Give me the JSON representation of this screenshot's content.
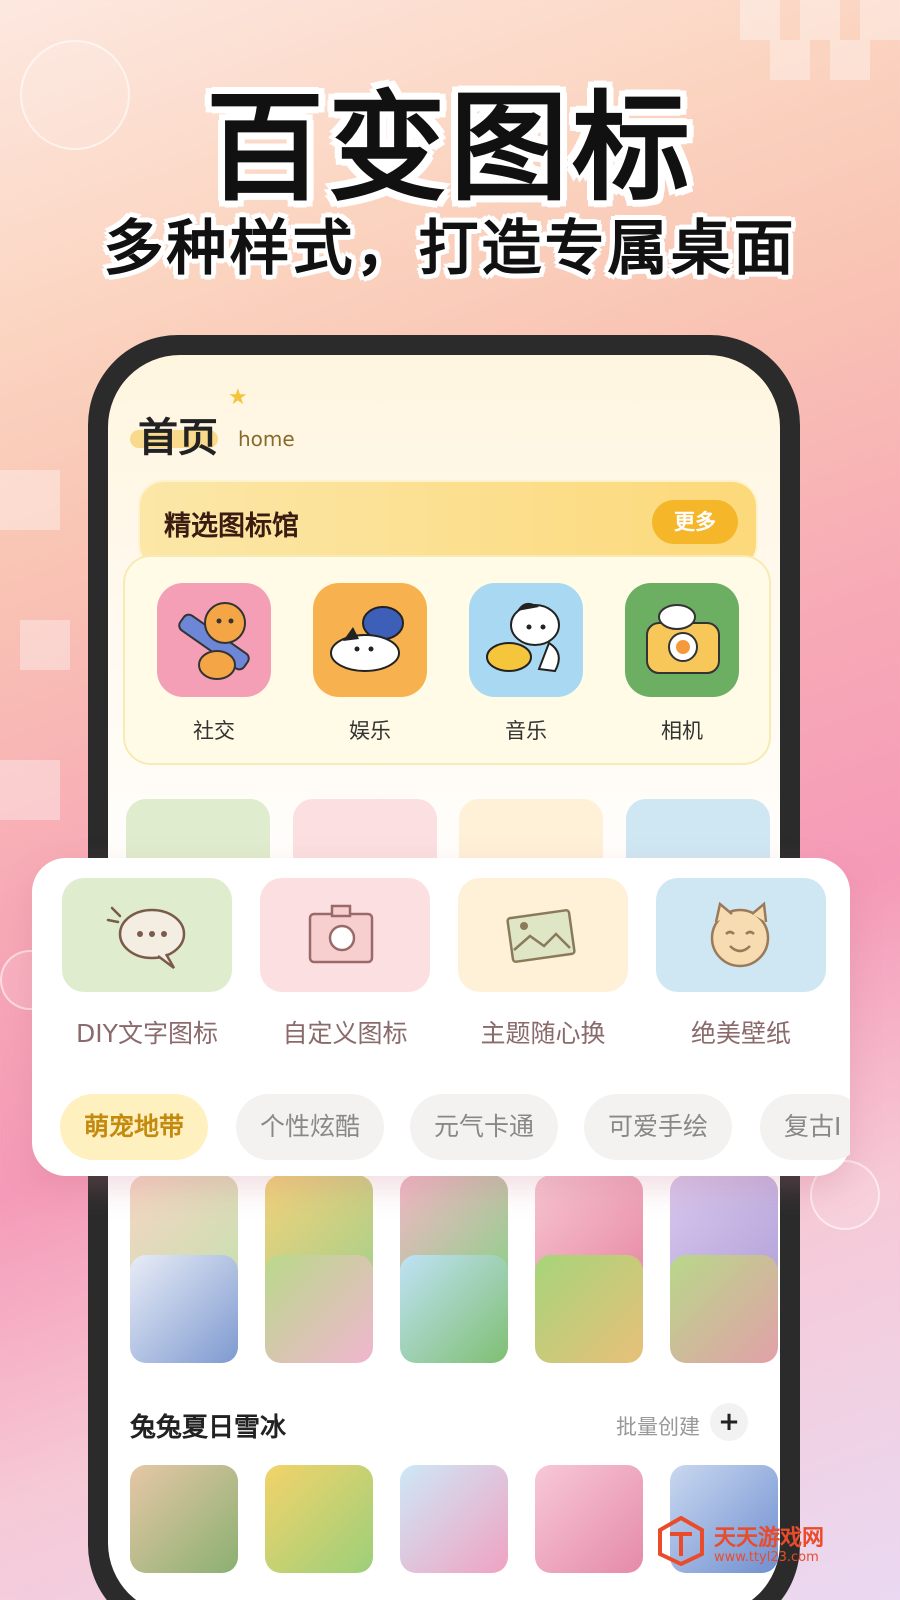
{
  "headline": "百变图标",
  "subline": "多种样式，打造专属桌面",
  "screen": {
    "home_title": "首页",
    "home_sub": "home",
    "featured_title": "精选图标馆",
    "more_label": "更多",
    "apps": [
      {
        "label": "社交",
        "icon": "tiger-pencil-icon",
        "color": "#f59fb6"
      },
      {
        "label": "娱乐",
        "icon": "dog-rabbit-icon",
        "color": "#f7b24f"
      },
      {
        "label": "音乐",
        "icon": "dog-duck-icon",
        "color": "#a9d8f2"
      },
      {
        "label": "相机",
        "icon": "camera-icon",
        "color": "#6cae62"
      }
    ],
    "section_title": "兔兔夏日雪冰",
    "batch_label": "批量创建",
    "plus_label": "+"
  },
  "features": [
    {
      "label": "DIY文字图标",
      "icon": "chat-bubble-icon",
      "color": "#dfeccd"
    },
    {
      "label": "自定义图标",
      "icon": "camera-icon",
      "color": "#fcdfe0"
    },
    {
      "label": "主题随心换",
      "icon": "picture-icon",
      "color": "#fff0d8"
    },
    {
      "label": "绝美壁纸",
      "icon": "cat-face-icon",
      "color": "#cfe7f3"
    }
  ],
  "chips": [
    {
      "label": "萌宠地带",
      "active": true
    },
    {
      "label": "个性炫酷",
      "active": false
    },
    {
      "label": "元气卡通",
      "active": false
    },
    {
      "label": "可爱手绘",
      "active": false
    },
    {
      "label": "复古I",
      "active": false
    }
  ],
  "watermark": {
    "name": "天天游戏网",
    "url": "www.ttyl23.com"
  }
}
